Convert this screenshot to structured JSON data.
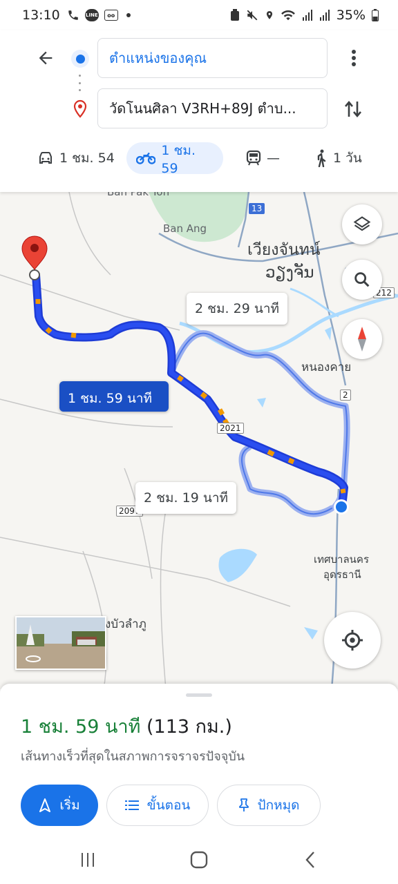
{
  "status_bar": {
    "time": "13:10",
    "battery": "35%",
    "icons": [
      "call-icon",
      "line-app-icon",
      "voicemail-icon",
      "dot-icon",
      "lock-battery-icon",
      "mute-icon",
      "location-icon",
      "wifi-icon",
      "signal-icon",
      "signal-icon"
    ]
  },
  "header": {
    "origin": "ตำแหน่งของคุณ",
    "destination": "วัดโนนศิลา V3RH+89J ตำบ...",
    "modes": [
      {
        "name": "car",
        "label": "1 ชม. 54",
        "active": false
      },
      {
        "name": "motorcycle",
        "label": "1 ชม. 59",
        "active": true
      },
      {
        "name": "transit",
        "label": "—",
        "active": false
      },
      {
        "name": "walk",
        "label": "1 วัน",
        "active": false
      }
    ]
  },
  "map": {
    "labels": {
      "ban_phak_ton": "Ban Pak Ton",
      "ban_ang": "Ban Ang",
      "vientiane_th": "เวียงจันทน์",
      "vientiane_lao": "ວຽງຈັນ",
      "nong_khai": "หนองคาย",
      "udon_city_1": "เทศบาลนคร",
      "udon_city_2": "อุดรธานี",
      "bua_lam_phu": "งบัวลำภู"
    },
    "shields": {
      "r13": "13",
      "r212": "212",
      "r2": "2",
      "r2021": "2021",
      "r2097": "2097"
    },
    "bubbles": {
      "alt1": "2 ชม. 29 นาที",
      "main": "1 ชม. 59 นาที",
      "alt2": "2 ชม. 19 นาที"
    }
  },
  "sheet": {
    "duration": "1 ชม. 59 นาที",
    "distance": "(113 กม.)",
    "subtitle": "เส้นทางเร็วที่สุดในสภาพการจราจรปัจจุบัน",
    "buttons": {
      "start": "เริ่ม",
      "steps": "ขั้นตอน",
      "pin": "ปักหมุด"
    }
  },
  "colors": {
    "accent": "#1a73e8",
    "route_main": "#2a44e8",
    "route_alt": "#9bb0f0",
    "duration_green": "#188038"
  }
}
